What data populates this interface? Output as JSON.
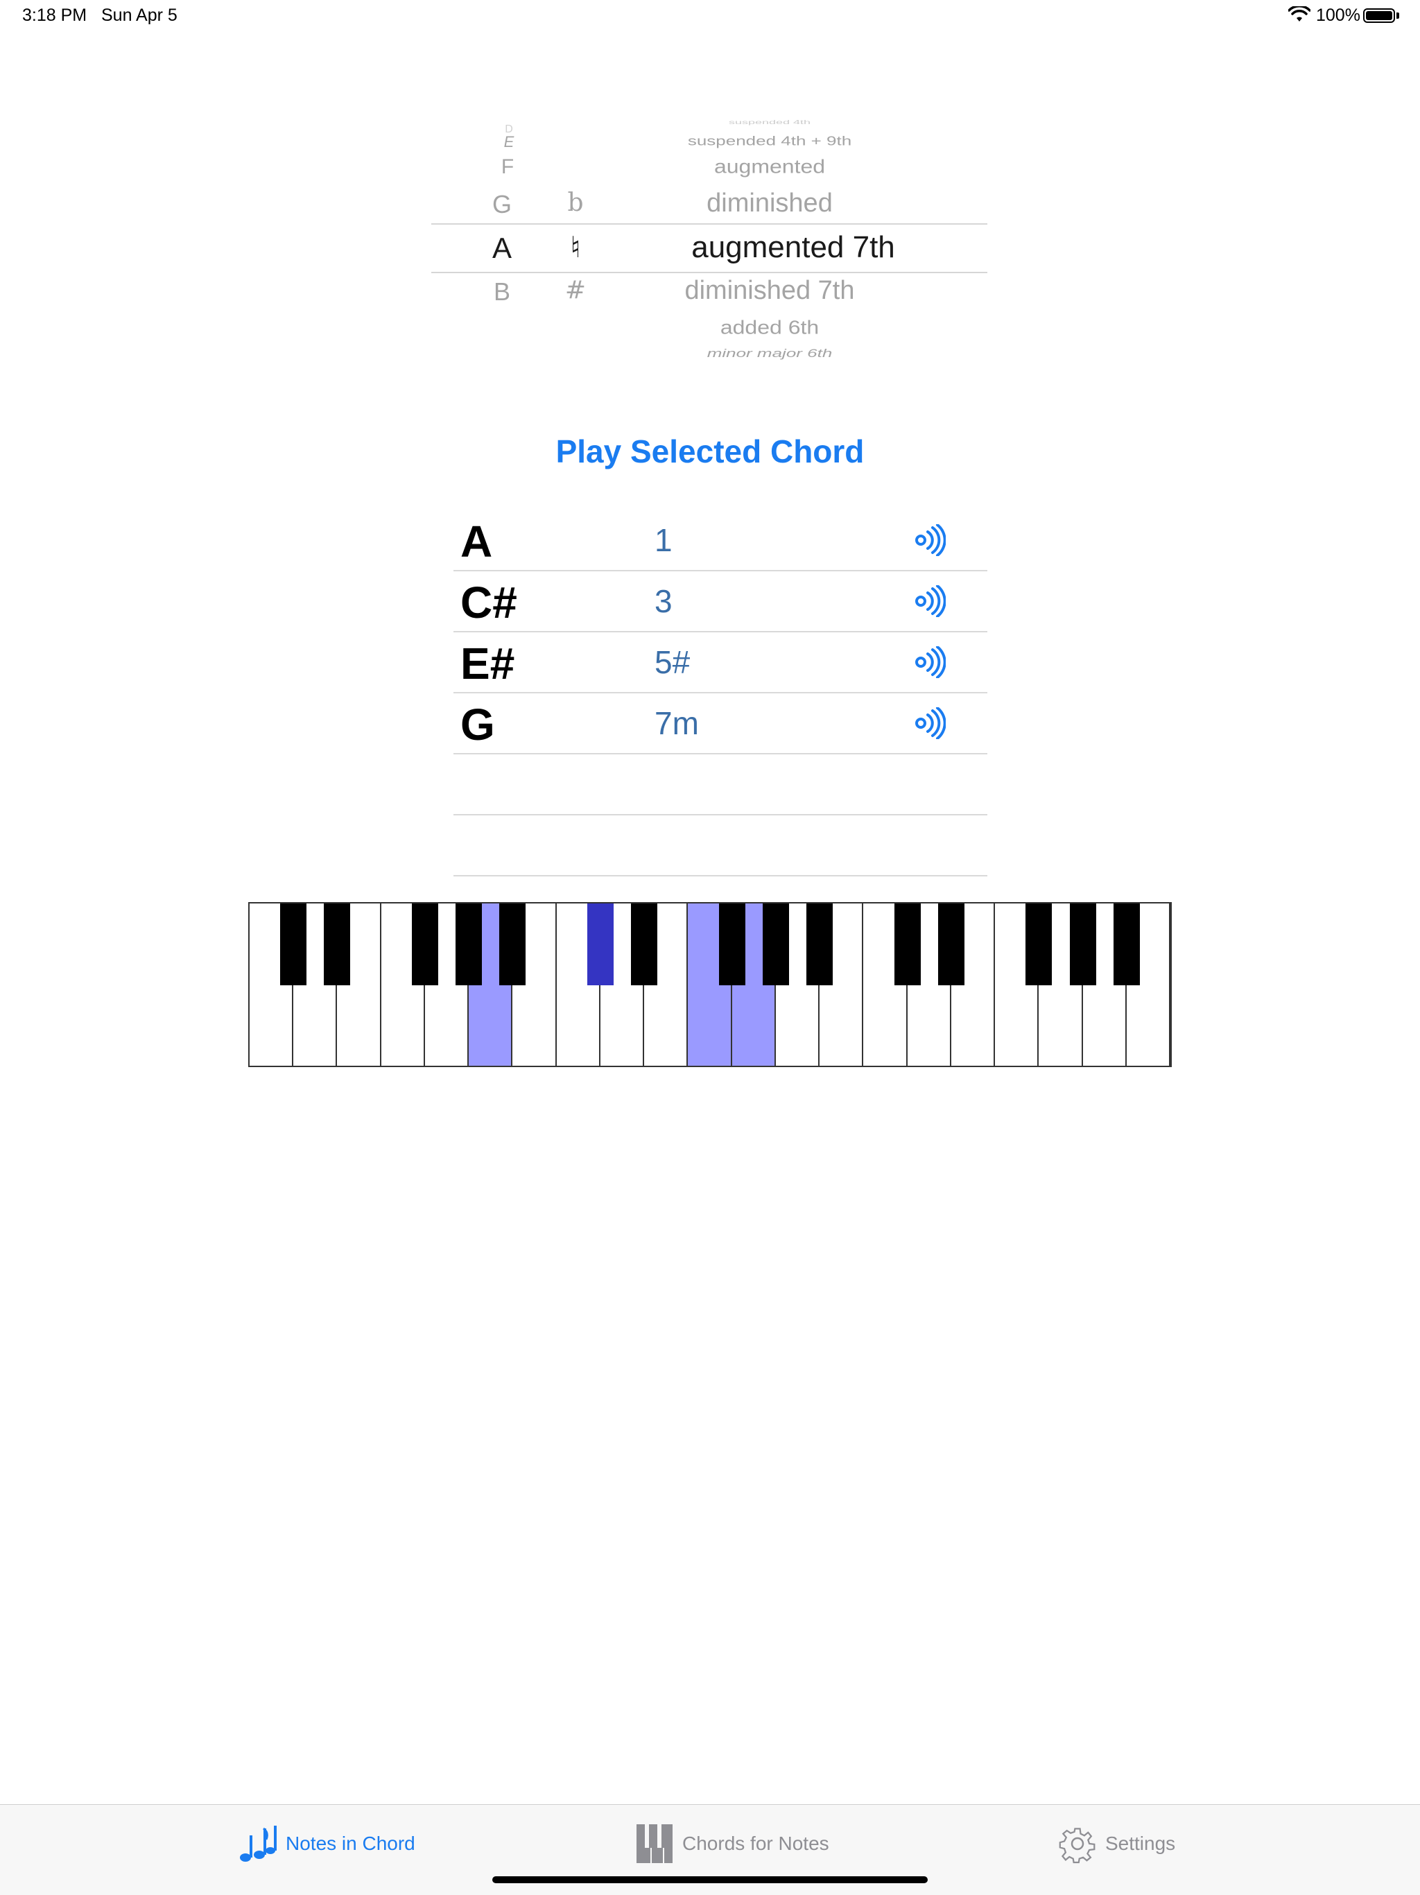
{
  "status_bar": {
    "time": "3:18 PM",
    "date": "Sun Apr 5",
    "battery": "100%"
  },
  "picker": {
    "root_column": [
      "D",
      "E",
      "F",
      "G",
      "A",
      "B"
    ],
    "accidental_column": [
      "b",
      "♮",
      "#"
    ],
    "quality_column": [
      "suspended 4th",
      "suspended 4th + 9th",
      "augmented",
      "diminished",
      "augmented 7th",
      "diminished 7th",
      "added 6th",
      "minor major 6th"
    ],
    "selected": {
      "root": "A",
      "accidental": "♮",
      "quality": "augmented 7th"
    }
  },
  "play_button_label": "Play Selected Chord",
  "chord_notes": [
    {
      "note": "A",
      "degree": "1"
    },
    {
      "note": "C#",
      "degree": "3"
    },
    {
      "note": "E#",
      "degree": "5#"
    },
    {
      "note": "G",
      "degree": "7m"
    }
  ],
  "keyboard": {
    "highlighted_white_keys": [
      5,
      10,
      11
    ],
    "highlighted_black_keys": [
      5
    ],
    "accent_color": "#9a9aff",
    "accent_dark_color": "#3434c2"
  },
  "tabs": [
    {
      "label": "Notes in Chord",
      "icon": "music-notes-icon",
      "active": true
    },
    {
      "label": "Chords for Notes",
      "icon": "piano-keys-icon",
      "active": false
    },
    {
      "label": "Settings",
      "icon": "gear-icon",
      "active": false
    }
  ],
  "colors": {
    "accent": "#1a7cf0",
    "degree_text": "#3a6ea8"
  }
}
